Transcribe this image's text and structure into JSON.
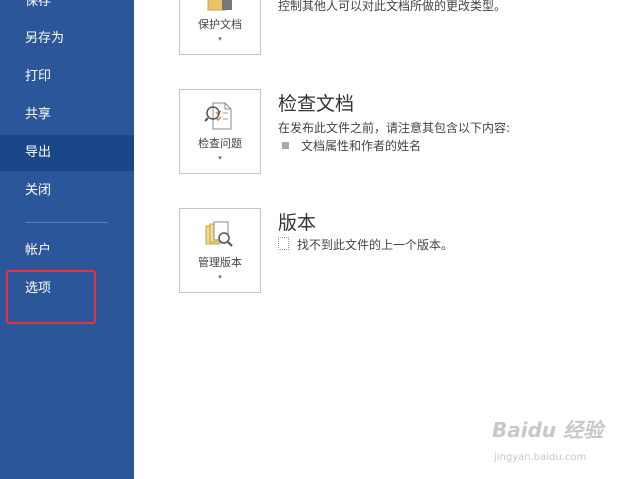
{
  "sidebar": {
    "items": [
      {
        "label": "保存"
      },
      {
        "label": "另存为"
      },
      {
        "label": "打印"
      },
      {
        "label": "共享"
      },
      {
        "label": "导出",
        "active": true
      },
      {
        "label": "关闭"
      },
      {
        "label": "帐户"
      },
      {
        "label": "选项",
        "highlighted": true
      }
    ],
    "bg_color": "#2b579a",
    "active_color": "#19478a",
    "highlight_color": "#e8303f"
  },
  "protect": {
    "tile_label": "保护文档",
    "caret": "▾",
    "description": "控制其他人可以对此文档所做的更改类型。",
    "icon": "lock-folder-icon"
  },
  "inspect": {
    "title": "检查文档",
    "tile_label": "检查问题",
    "caret": "▾",
    "description": "在发布此文件之前，请注意其包含以下内容:",
    "bullets": [
      "文档属性和作者的姓名"
    ],
    "icon": "checklist-magnifier-icon"
  },
  "versions": {
    "title": "版本",
    "tile_label": "管理版本",
    "caret": "▾",
    "description": "找不到此文件的上一个版本。",
    "icon": "stacked-documents-magnifier-icon"
  },
  "watermark": {
    "brand": "Baidu 经验",
    "url": "jingyan.baidu.com"
  }
}
